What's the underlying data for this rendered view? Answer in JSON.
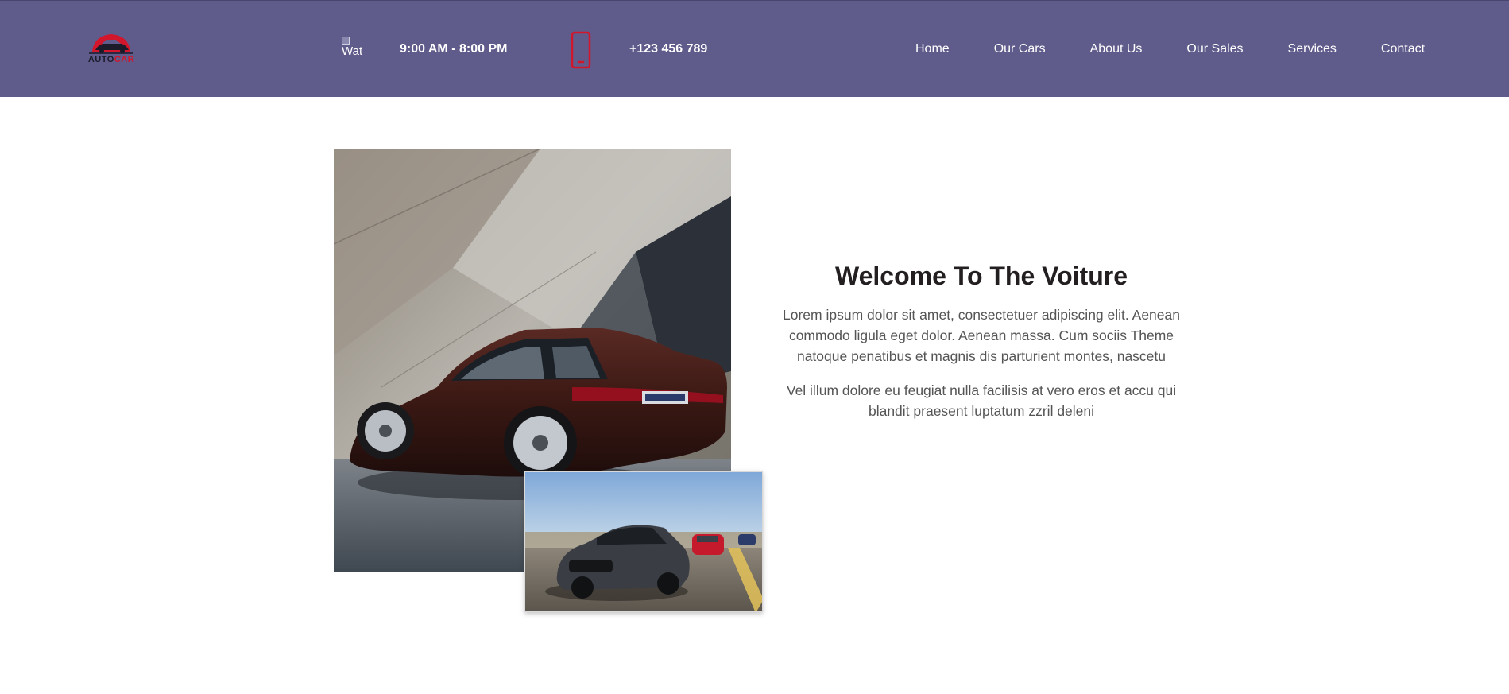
{
  "brand": {
    "logo_text_1": "AUTO",
    "logo_text_2": "CAR",
    "header_color": "#5f5b8b",
    "accent_color": "#d2162b"
  },
  "header": {
    "hours_icon": "clock-icon",
    "hours_icon_alt": "Watch",
    "hours": "9:00 AM - 8:00 PM",
    "phone_icon": "mobile-phone-icon",
    "phone": "+123 456 789"
  },
  "nav": {
    "items": [
      {
        "label": "Home"
      },
      {
        "label": "Our Cars"
      },
      {
        "label": "About Us"
      },
      {
        "label": "Our Sales"
      },
      {
        "label": "Services"
      },
      {
        "label": "Contact"
      }
    ]
  },
  "welcome": {
    "title": "Welcome To The Voiture",
    "paragraph_1": "Lorem ipsum dolor sit amet, consectetuer adipiscing elit. Aenean commodo ligula eget dolor. Aenean massa. Cum sociis Theme natoque penatibus et magnis dis parturient montes, nascetu",
    "paragraph_2": "Vel illum dolore eu feugiat nulla facilisis at vero eros et accu qui blandit praesent luptatum zzril deleni"
  }
}
